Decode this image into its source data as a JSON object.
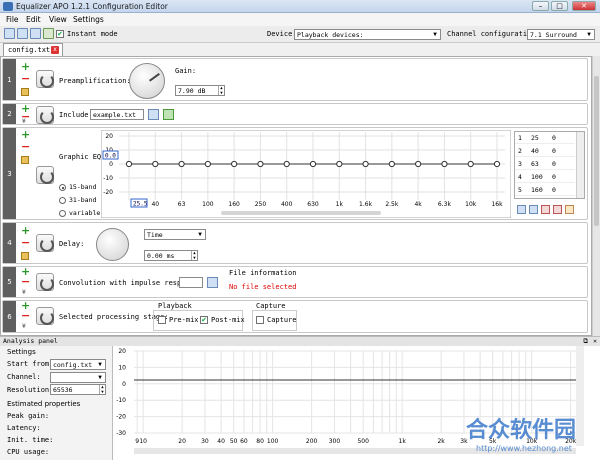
{
  "window": {
    "title": "Equalizer APO 1.2.1 Configuration Editor",
    "minimize": "–",
    "maximize": "□",
    "close": "✕"
  },
  "menu": [
    "File",
    "Edit",
    "View",
    "Settings"
  ],
  "toolbar": {
    "instant_mode_label": "Instant mode",
    "instant_mode_checked": true,
    "device_label": "Device:",
    "device_value": "Playback devices:",
    "channel_label": "Channel configuration:",
    "channel_value": "7.1 Surround"
  },
  "tab": {
    "label": "config.txt",
    "close": "x"
  },
  "rows": {
    "r1": {
      "num": "1",
      "label": "Preamplification:",
      "gain_label": "Gain:",
      "gain_value": "7.90 dB",
      "preamp_fraction": 0.7
    },
    "r2": {
      "num": "2",
      "label": "Include:",
      "file": "example.txt"
    },
    "r3": {
      "num": "3",
      "label": "Graphic EQ:",
      "modes": [
        "15-band",
        "31-band",
        "variable"
      ],
      "selected_mode": "15-band",
      "y_ticks": [
        "20",
        "10",
        "0",
        "-10",
        "-20"
      ],
      "x_ticks": [
        "25",
        "40",
        "63",
        "100",
        "160",
        "250",
        "400",
        "630",
        "1k",
        "1.6k",
        "2.5k",
        "4k",
        "6.3k",
        "10k",
        "16k"
      ],
      "marker_top": "0.0",
      "marker_bottom": "25.5",
      "bands": [
        {
          "idx": "1",
          "freq": "25",
          "gain": "0"
        },
        {
          "idx": "2",
          "freq": "40",
          "gain": "0"
        },
        {
          "idx": "3",
          "freq": "63",
          "gain": "0"
        },
        {
          "idx": "4",
          "freq": "100",
          "gain": "0"
        },
        {
          "idx": "5",
          "freq": "160",
          "gain": "0"
        }
      ]
    },
    "r4": {
      "num": "4",
      "label": "Delay:",
      "unit": "Time",
      "value": "0.00 ms"
    },
    "r5": {
      "num": "5",
      "label": "Convolution with impulse response:",
      "info_title": "File information",
      "info_status": "No file selected"
    },
    "r6": {
      "num": "6",
      "label": "Selected processing stage:",
      "playback": "Playback",
      "pre_mix": "Pre-mix",
      "post_mix": "Post-mix",
      "post_mix_checked": true,
      "capture_group": "Capture",
      "capture": "Capture"
    }
  },
  "analysis": {
    "title": "Analysis panel",
    "settings": "Settings",
    "start_from_label": "Start from:",
    "start_from_value": "config.txt",
    "channel_label": "Channel:",
    "channel_value": "",
    "resolution_label": "Resolution:",
    "resolution_value": "65536",
    "estimated": "Estimated properties",
    "peak_gain": "Peak gain:",
    "latency": "Latency:",
    "init_time": "Init. time:",
    "cpu_usage": "CPU usage:",
    "y_ticks": [
      "20",
      "10",
      "0",
      "-10",
      "-20",
      "-30"
    ],
    "x_ticks": [
      "9",
      "10",
      "20",
      "30",
      "40",
      "50",
      "60",
      "80",
      "100",
      "200",
      "300",
      "500",
      "1k",
      "2k",
      "3k",
      "5k",
      "10k",
      "20k"
    ]
  },
  "watermark": {
    "cn": "合众软件园",
    "url": "http://www.hezhong.net"
  }
}
